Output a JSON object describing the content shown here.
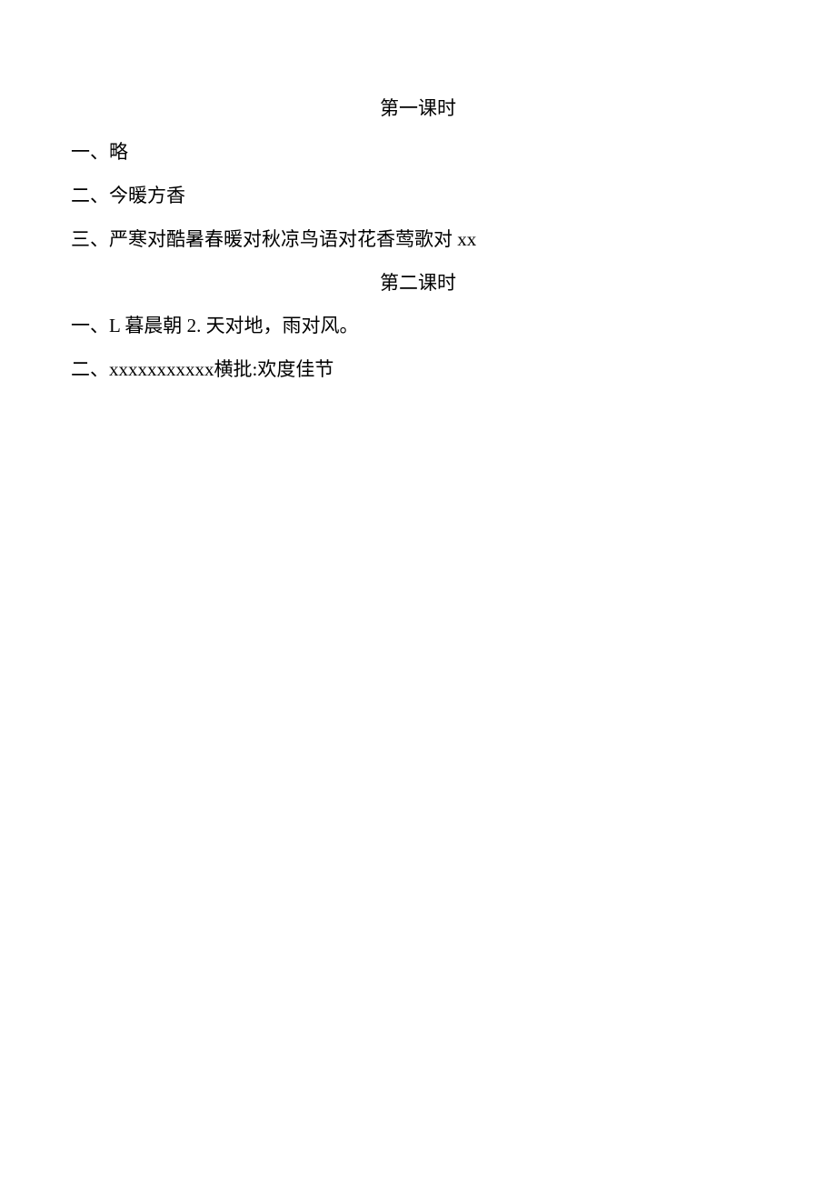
{
  "section1": {
    "heading": "第一课时",
    "line1": "一、略",
    "line2": "二、今暖方香",
    "line3_prefix": "三、严寒对酷暑春暖对秋凉鸟语对花香莺歌对 ",
    "line3_latin": "xx"
  },
  "section2": {
    "heading": "第二课时",
    "line1_prefix": "一、",
    "line1_latin1": "L ",
    "line1_mid1": "暮晨朝 ",
    "line1_latin2": "2. ",
    "line1_tail": "天对地，雨对风。",
    "line2_prefix": "二、",
    "line2_latin": "xxxxxxxxxxx",
    "line2_tail": "横批:欢度佳节"
  }
}
